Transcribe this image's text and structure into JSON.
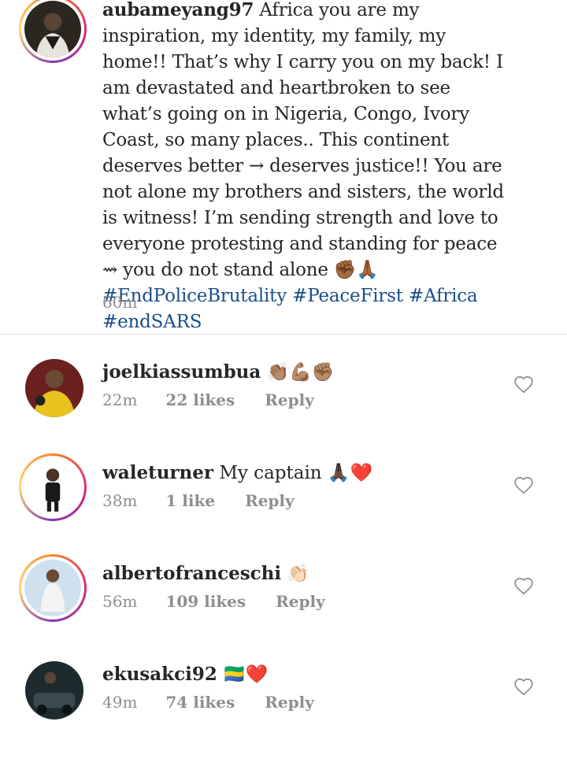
{
  "post": {
    "username": "aubameyang97",
    "caption": " Africa you are my inspiration, my identity, my family, my home!! That’s why I carry you on my back! I am devastated and heartbroken to see what’s going on in Nigeria, Congo, Ivory Coast, so many places.. This continent deserves better → deserves justice!! You are not alone my brothers and sisters, the world is witness! I’m sending strength and love to everyone protesting and standing for peace ⇝ you do not stand alone ",
    "emojis": "✊🏾🙏🏾",
    "hashtags": "#EndPoliceBrutality #PeaceFirst #Africa #endSARS",
    "time": "60m"
  },
  "comments": [
    {
      "username": "joelkiassumbua",
      "text": " 👏🏽💪🏽✊🏽",
      "time": "22m",
      "likes": "22 likes",
      "reply": "Reply"
    },
    {
      "username": "waleturner",
      "text": " My captain 🙏🏿❤️",
      "time": "38m",
      "likes": "1 like",
      "reply": "Reply"
    },
    {
      "username": "albertofranceschi",
      "text": " 👏🏻",
      "time": "56m",
      "likes": "109 likes",
      "reply": "Reply"
    },
    {
      "username": "ekusakci92",
      "text": " 🇬🇦❤️",
      "time": "49m",
      "likes": "74 likes",
      "reply": "Reply"
    }
  ],
  "colors": {
    "hashtag": "#1a4e8a",
    "meta": "#8e8e8e",
    "divider": "#dbdbdb"
  }
}
